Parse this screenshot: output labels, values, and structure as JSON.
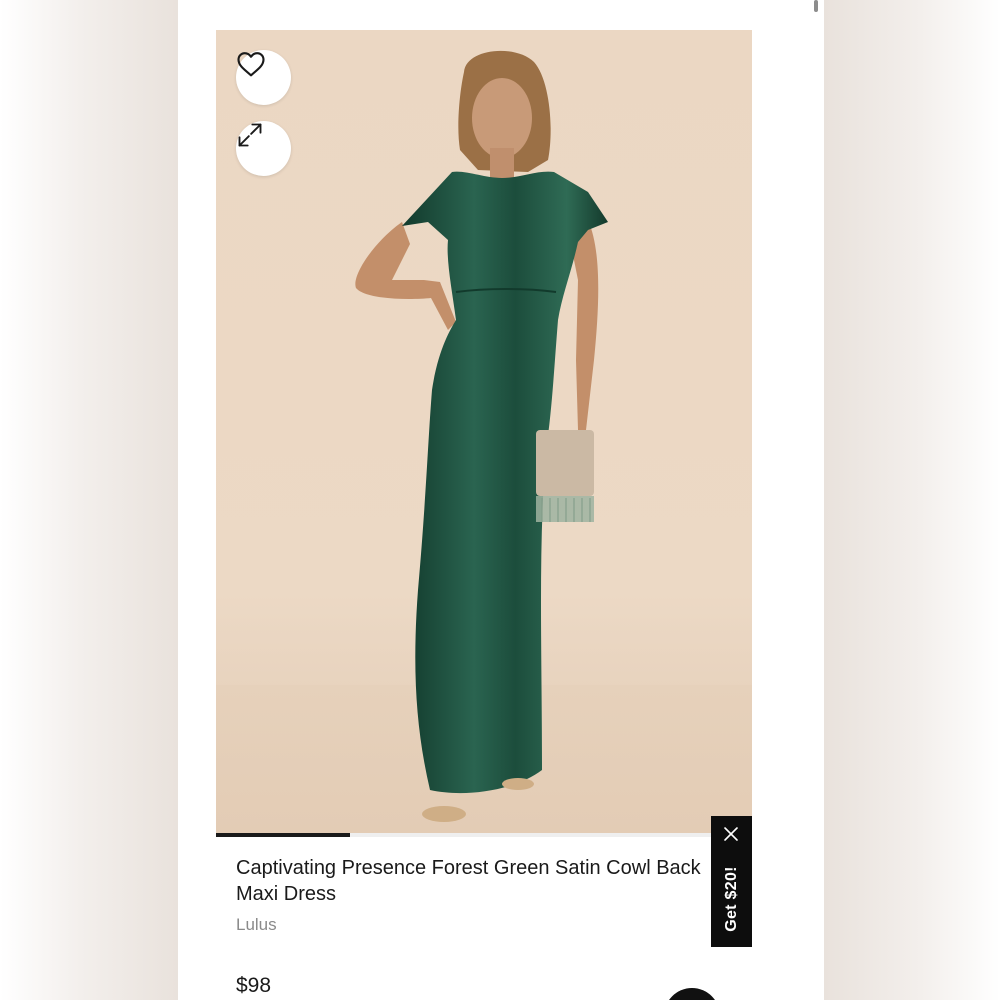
{
  "product": {
    "title": "Captivating Presence Forest Green Satin Cowl Back Maxi Dress",
    "brand": "Lulus",
    "price": "$98",
    "image_alt": "Model wearing forest green satin maxi dress"
  },
  "actions": {
    "favorite_icon": "heart-icon",
    "expand_icon": "expand-icon"
  },
  "carousel": {
    "progress": 0.25
  },
  "promo": {
    "label": "Get $20!",
    "close_icon": "close-icon"
  },
  "colors": {
    "dress": "#1f4d3c",
    "background": "#ebd7c3",
    "promo_bg": "#0d0d0d",
    "text": "#1a1a1a",
    "muted": "#8a8a8a"
  }
}
